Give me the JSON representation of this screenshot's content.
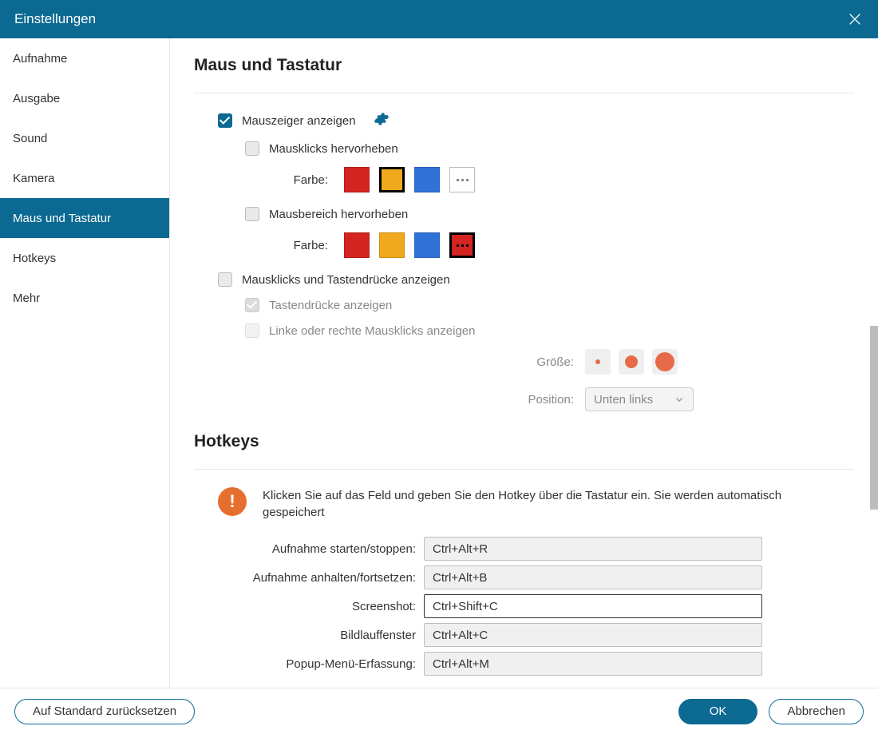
{
  "window": {
    "title": "Einstellungen"
  },
  "sidebar": {
    "items": [
      {
        "label": "Aufnahme"
      },
      {
        "label": "Ausgabe"
      },
      {
        "label": "Sound"
      },
      {
        "label": "Kamera"
      },
      {
        "label": "Maus und Tastatur"
      },
      {
        "label": "Hotkeys"
      },
      {
        "label": "Mehr"
      }
    ],
    "activeIndex": 4
  },
  "sections": {
    "mouse": {
      "title": "Maus und Tastatur",
      "show_cursor": "Mauszeiger anzeigen",
      "highlight_clicks": "Mausklicks hervorheben",
      "highlight_area": "Mausbereich hervorheben",
      "show_clicks_keys": "Mausklicks und Tastendrücke anzeigen",
      "show_keys": "Tastendrücke anzeigen",
      "show_lr_clicks": "Linke oder rechte Mausklicks anzeigen",
      "color_label": "Farbe:",
      "size_label": "Größe:",
      "position_label": "Position:",
      "position_value": "Unten links",
      "colors": {
        "click": {
          "options": [
            "#d32421",
            "#f0a91c",
            "#2f72d8"
          ],
          "selected": 1
        },
        "area": {
          "options": [
            "#d32421",
            "#f0a91c",
            "#2f72d8"
          ],
          "selected": 0,
          "custom": "#d32421"
        }
      }
    },
    "hotkeys": {
      "title": "Hotkeys",
      "notice": "Klicken Sie auf das Feld und geben Sie den Hotkey über die Tastatur ein. Sie werden automatisch gespeichert",
      "rows": [
        {
          "label": "Aufnahme starten/stoppen:",
          "value": "Ctrl+Alt+R"
        },
        {
          "label": "Aufnahme anhalten/fortsetzen:",
          "value": "Ctrl+Alt+B"
        },
        {
          "label": "Screenshot:",
          "value": "Ctrl+Shift+C"
        },
        {
          "label": "Bildlauffenster",
          "value": "Ctrl+Alt+C"
        },
        {
          "label": "Popup-Menü-Erfassung:",
          "value": "Ctrl+Alt+M"
        }
      ],
      "activeIndex": 2
    }
  },
  "footer": {
    "reset": "Auf Standard zurücksetzen",
    "ok": "OK",
    "cancel": "Abbrechen"
  }
}
